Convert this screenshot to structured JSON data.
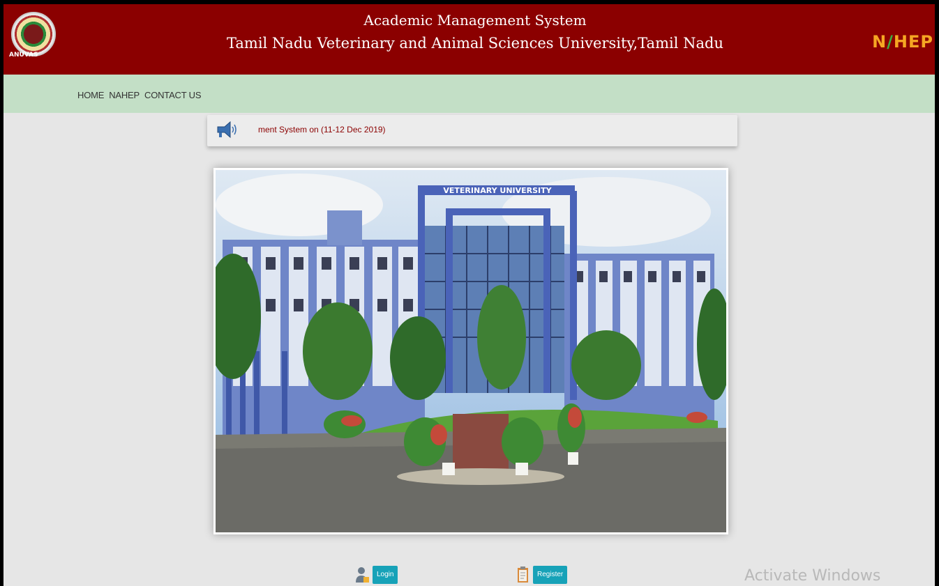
{
  "header": {
    "title_line1": "Academic Management System",
    "title_line2": "Tamil Nadu Veterinary and Animal Sciences University,Tamil Nadu",
    "logo_left_text": "ANUVAS",
    "logo_right_text_1": "N",
    "logo_right_text_2": "HEP"
  },
  "nav": {
    "items": [
      "HOME",
      "NAHEP",
      "CONTACT US"
    ]
  },
  "announcement": {
    "text": "ment System on (11-12 Dec 2019)",
    "icon": "megaphone-icon"
  },
  "banner": {
    "sign_text": "VETERINARY UNIVERSITY"
  },
  "actions": {
    "login_label": "Login",
    "register_label": "Register",
    "login_icon": "user-lock-icon",
    "register_icon": "clipboard-edit-icon"
  },
  "overlay": {
    "watermark": "Activate Windows"
  },
  "colors": {
    "header_bg": "#8b0000",
    "nav_bg": "#c3dfc6",
    "button": "#17a2b8",
    "announcement_text": "#8b0000"
  }
}
